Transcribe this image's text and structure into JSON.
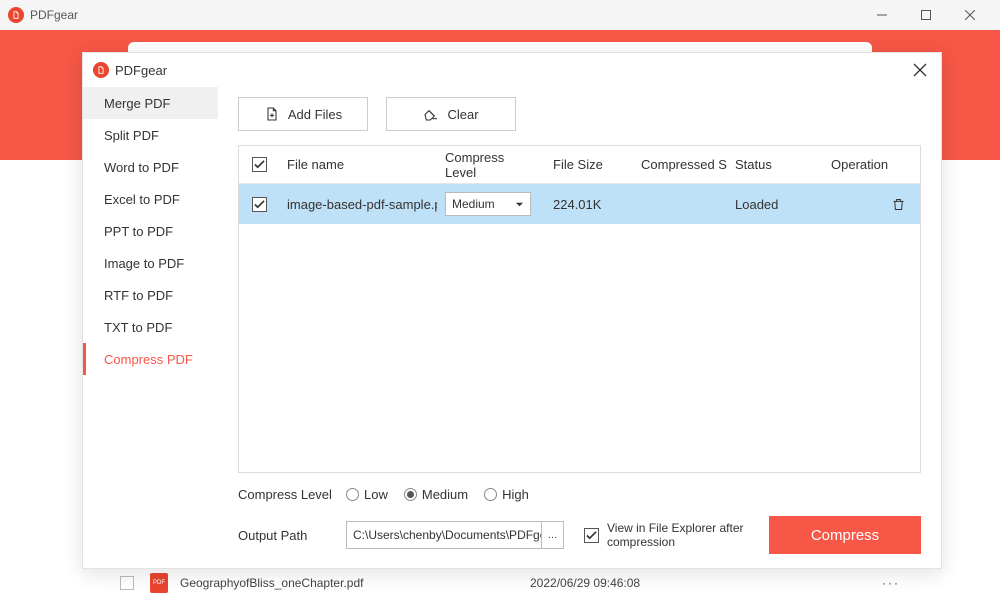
{
  "app_name": "PDFgear",
  "modal_title": "PDFgear",
  "sidebar": {
    "items": [
      {
        "label": "Merge PDF"
      },
      {
        "label": "Split PDF"
      },
      {
        "label": "Word to PDF"
      },
      {
        "label": "Excel to PDF"
      },
      {
        "label": "PPT to PDF"
      },
      {
        "label": "Image to PDF"
      },
      {
        "label": "RTF to PDF"
      },
      {
        "label": "TXT to PDF"
      },
      {
        "label": "Compress PDF"
      }
    ]
  },
  "toolbar": {
    "add_files": "Add Files",
    "clear": "Clear"
  },
  "table": {
    "headers": {
      "filename": "File name",
      "level": "Compress Level",
      "size": "File Size",
      "csize": "Compressed S",
      "status": "Status",
      "operation": "Operation"
    },
    "rows": [
      {
        "checked": true,
        "filename": "image-based-pdf-sample.pdf",
        "level": "Medium",
        "size": "224.01K",
        "csize": "",
        "status": "Loaded"
      }
    ]
  },
  "bottom": {
    "compress_level_label": "Compress Level",
    "levels": {
      "low": "Low",
      "medium": "Medium",
      "high": "High"
    },
    "selected_level": "medium",
    "output_label": "Output Path",
    "output_path": "C:\\Users\\chenby\\Documents\\PDFgear",
    "view_in_explorer": "View in File Explorer after compression",
    "compress_btn": "Compress"
  },
  "background": {
    "filename": "GeographyofBliss_oneChapter.pdf",
    "date": "2022/06/29 09:46:08",
    "more": "···"
  }
}
